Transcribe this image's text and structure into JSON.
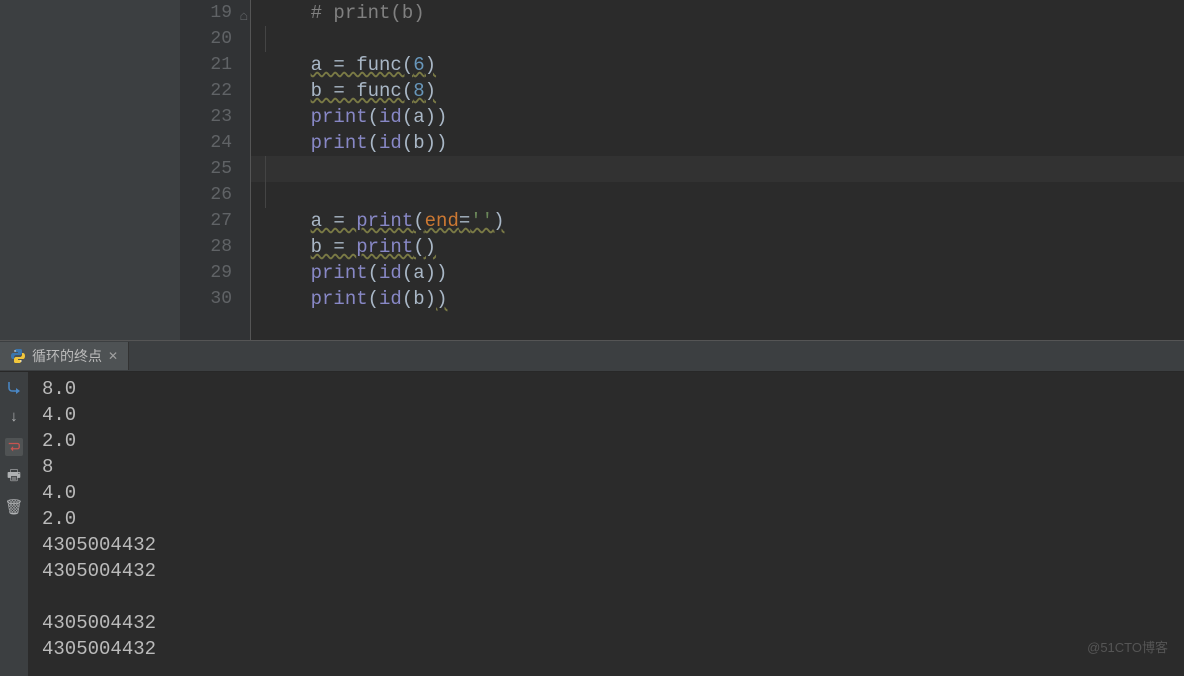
{
  "editor": {
    "gutter_start": 19,
    "lines": {
      "19": {
        "tokens": [
          {
            "t": "    ",
            "c": "tok-default"
          },
          {
            "t": "# print(b)",
            "c": "tok-comment"
          }
        ],
        "fold_icon": true
      },
      "20": {
        "tokens": []
      },
      "21": {
        "tokens": [
          {
            "t": "    ",
            "c": ""
          },
          {
            "t": "a = func(",
            "c": "tok-default underline-warn"
          },
          {
            "t": "6",
            "c": "tok-num underline-warn"
          },
          {
            "t": ")",
            "c": "tok-default underline-warn"
          }
        ]
      },
      "22": {
        "tokens": [
          {
            "t": "    ",
            "c": ""
          },
          {
            "t": "b = func(",
            "c": "tok-default underline-warn"
          },
          {
            "t": "8",
            "c": "tok-num underline-warn"
          },
          {
            "t": ")",
            "c": "tok-default underline-warn"
          }
        ]
      },
      "23": {
        "tokens": [
          {
            "t": "    ",
            "c": ""
          },
          {
            "t": "print",
            "c": "tok-builtin"
          },
          {
            "t": "(",
            "c": "tok-default"
          },
          {
            "t": "id",
            "c": "tok-builtin"
          },
          {
            "t": "(a))",
            "c": "tok-default"
          }
        ]
      },
      "24": {
        "tokens": [
          {
            "t": "    ",
            "c": ""
          },
          {
            "t": "print",
            "c": "tok-builtin"
          },
          {
            "t": "(",
            "c": "tok-default"
          },
          {
            "t": "id",
            "c": "tok-builtin"
          },
          {
            "t": "(b))",
            "c": "tok-default"
          }
        ]
      },
      "25": {
        "tokens": [],
        "highlight": true
      },
      "26": {
        "tokens": []
      },
      "27": {
        "tokens": [
          {
            "t": "    ",
            "c": ""
          },
          {
            "t": "a = ",
            "c": "tok-default underline-warn"
          },
          {
            "t": "print",
            "c": "tok-builtin underline-warn"
          },
          {
            "t": "(",
            "c": "tok-default underline-warn"
          },
          {
            "t": "end",
            "c": "tok-keyword underline-warn"
          },
          {
            "t": "=",
            "c": "tok-default underline-warn"
          },
          {
            "t": "''",
            "c": "tok-string underline-warn"
          },
          {
            "t": ")",
            "c": "tok-default underline-warn"
          }
        ]
      },
      "28": {
        "tokens": [
          {
            "t": "    ",
            "c": ""
          },
          {
            "t": "b = ",
            "c": "tok-default underline-warn"
          },
          {
            "t": "print",
            "c": "tok-builtin underline-warn"
          },
          {
            "t": "()",
            "c": "tok-default underline-warn"
          }
        ]
      },
      "29": {
        "tokens": [
          {
            "t": "    ",
            "c": ""
          },
          {
            "t": "print",
            "c": "tok-builtin"
          },
          {
            "t": "(",
            "c": "tok-default"
          },
          {
            "t": "id",
            "c": "tok-builtin"
          },
          {
            "t": "(a))",
            "c": "tok-default"
          }
        ]
      },
      "30": {
        "tokens": [
          {
            "t": "    ",
            "c": ""
          },
          {
            "t": "print",
            "c": "tok-builtin"
          },
          {
            "t": "(",
            "c": "tok-default"
          },
          {
            "t": "id",
            "c": "tok-builtin"
          },
          {
            "t": "(b)",
            "c": "tok-default"
          },
          {
            "t": ")",
            "c": "tok-default underline-warn"
          }
        ]
      }
    }
  },
  "tab": {
    "label": "循环的终点"
  },
  "console": {
    "lines": [
      "8.0",
      "4.0",
      "2.0",
      "8",
      "4.0",
      "2.0",
      "4305004432",
      "4305004432",
      "",
      "4305004432",
      "4305004432"
    ]
  },
  "watermark": "@51CTO博客"
}
